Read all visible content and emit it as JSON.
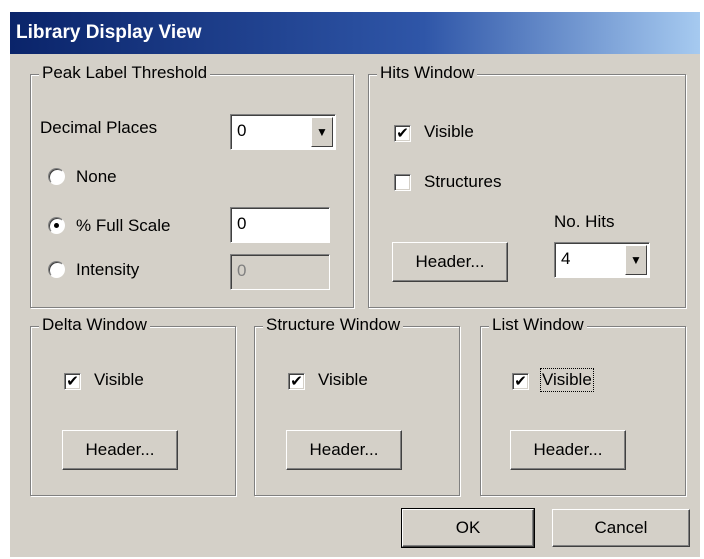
{
  "window": {
    "title": "Library Display View"
  },
  "peak_label": {
    "legend": "Peak Label Threshold",
    "decimal_places": {
      "label": "Decimal Places",
      "value": "0"
    },
    "none_label": "None",
    "full_scale": {
      "label": "% Full Scale",
      "value": "0",
      "selected": true
    },
    "intensity": {
      "label": "Intensity",
      "value": "0"
    }
  },
  "hits": {
    "legend": "Hits Window",
    "visible_label": "Visible",
    "visible_checked": true,
    "structures_label": "Structures",
    "structures_checked": false,
    "header_button": "Header...",
    "no_hits_label": "No. Hits",
    "no_hits_value": "4"
  },
  "delta": {
    "legend": "Delta Window",
    "visible_label": "Visible",
    "visible_checked": true,
    "header_button": "Header..."
  },
  "structure": {
    "legend": "Structure Window",
    "visible_label": "Visible",
    "visible_checked": true,
    "header_button": "Header..."
  },
  "list": {
    "legend": "List Window",
    "visible_label": "Visible",
    "visible_checked": true,
    "header_button": "Header..."
  },
  "buttons": {
    "ok": "OK",
    "cancel": "Cancel"
  },
  "glyphs": {
    "check": "✔",
    "arrow": "▼"
  },
  "colors": {
    "face": "#d4d0c8",
    "title_start": "#0a246a",
    "title_end": "#a6caf0"
  }
}
